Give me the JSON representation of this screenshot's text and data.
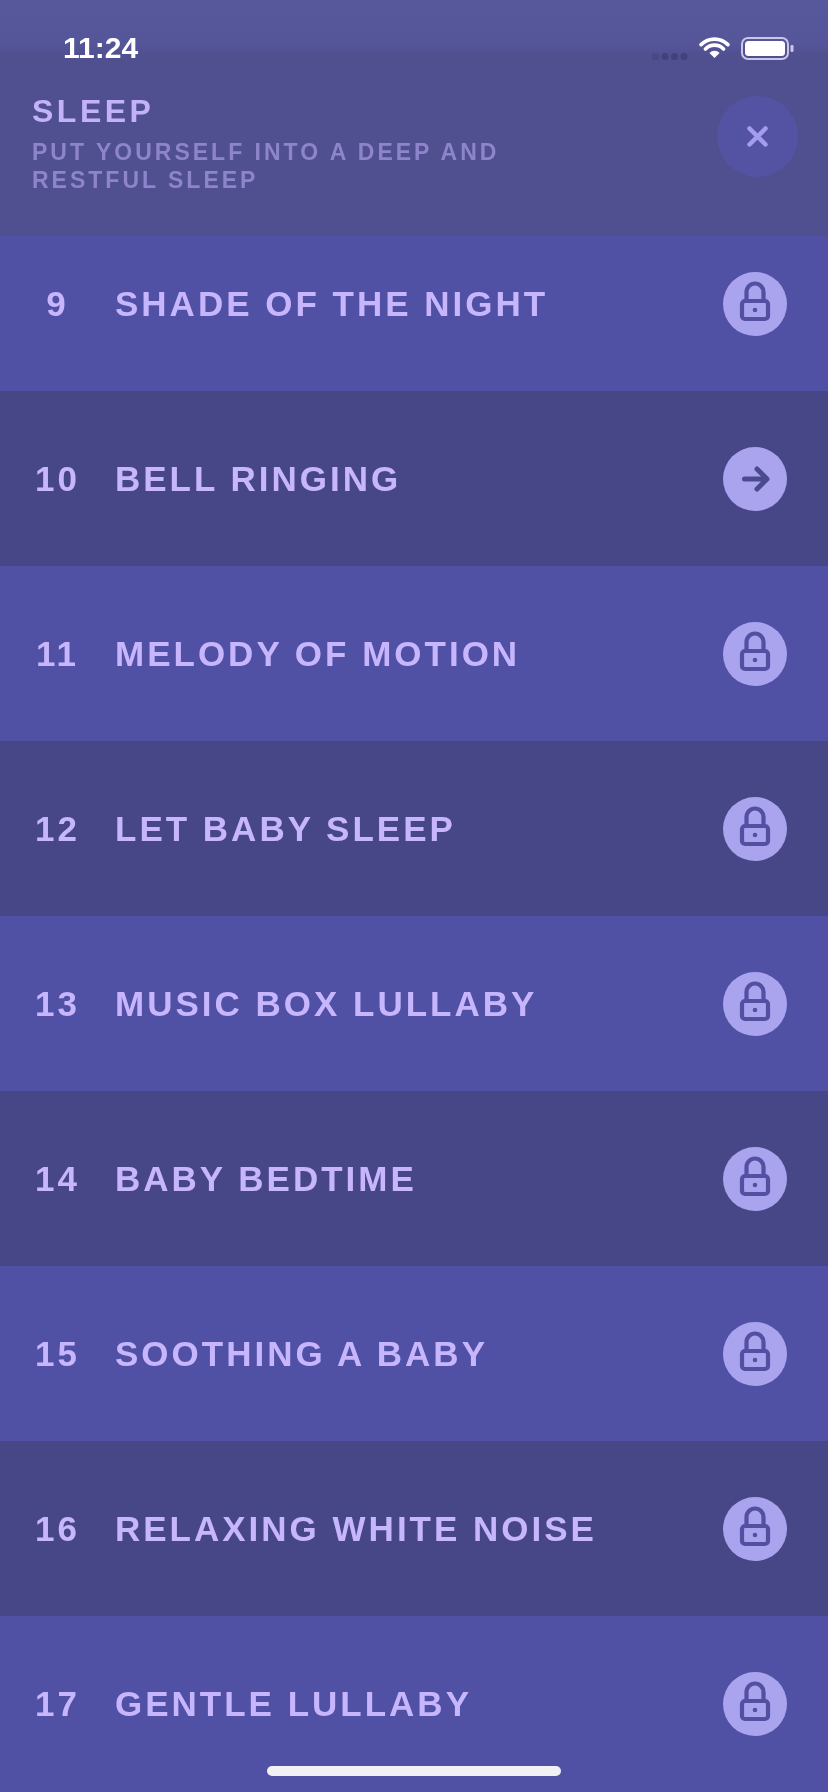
{
  "status_bar": {
    "time": "11:24"
  },
  "header": {
    "title": "SLEEP",
    "subtitle": "PUT YOURSELF INTO A DEEP AND RESTFUL SLEEP"
  },
  "tracks": [
    {
      "number": "9",
      "title": "SHADE OF THE NIGHT",
      "locked": true
    },
    {
      "number": "10",
      "title": "BELL RINGING",
      "locked": false
    },
    {
      "number": "11",
      "title": "MELODY OF MOTION",
      "locked": true
    },
    {
      "number": "12",
      "title": "LET BABY SLEEP",
      "locked": true
    },
    {
      "number": "13",
      "title": "MUSIC BOX LULLABY",
      "locked": true
    },
    {
      "number": "14",
      "title": "BABY BEDTIME",
      "locked": true
    },
    {
      "number": "15",
      "title": "SOOTHING A BABY",
      "locked": true
    },
    {
      "number": "16",
      "title": "RELAXING WHITE NOISE",
      "locked": true
    },
    {
      "number": "17",
      "title": "GENTLE LULLABY",
      "locked": true
    }
  ]
}
